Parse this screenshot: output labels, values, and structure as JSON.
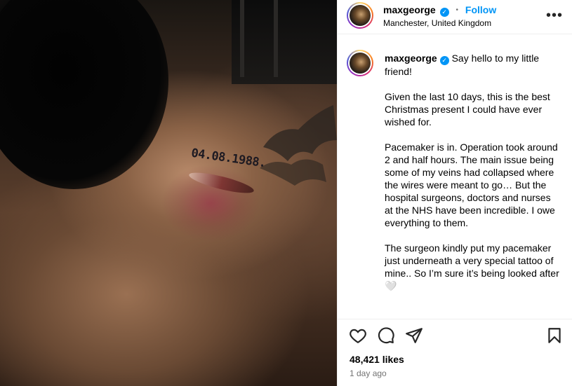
{
  "post": {
    "username": "maxgeorge",
    "follow_label": "Follow",
    "location": "Manchester, United Kingdom",
    "more_label": "•••",
    "image": {
      "tattoo_text": "04.08.1988."
    },
    "caption": {
      "paragraphs": [
        "Say hello to my little friend!",
        "Given the last 10 days, this is the best Christmas present I could have ever wished for.",
        "Pacemaker is in. Operation took around 2 and half hours. The main issue being some of my veins had collapsed where the wires were meant to go… But the hospital surgeons, doctors and nurses at the NHS have been incredible. I owe everything to them.",
        "The surgeon kindly put my pacemaker just underneath a very special tattoo of mine.. So I’m sure it’s being looked after 🤍"
      ]
    },
    "likes": "48,421 likes",
    "timestamp": "1 day ago",
    "colors": {
      "follow": "#0095f6",
      "verified": "#0095f6",
      "secondary_text": "#737373",
      "divider": "#efefef"
    },
    "icons": [
      "verified-icon",
      "more-options-icon",
      "like-heart-icon",
      "comment-icon",
      "share-icon",
      "save-bookmark-icon"
    ]
  }
}
